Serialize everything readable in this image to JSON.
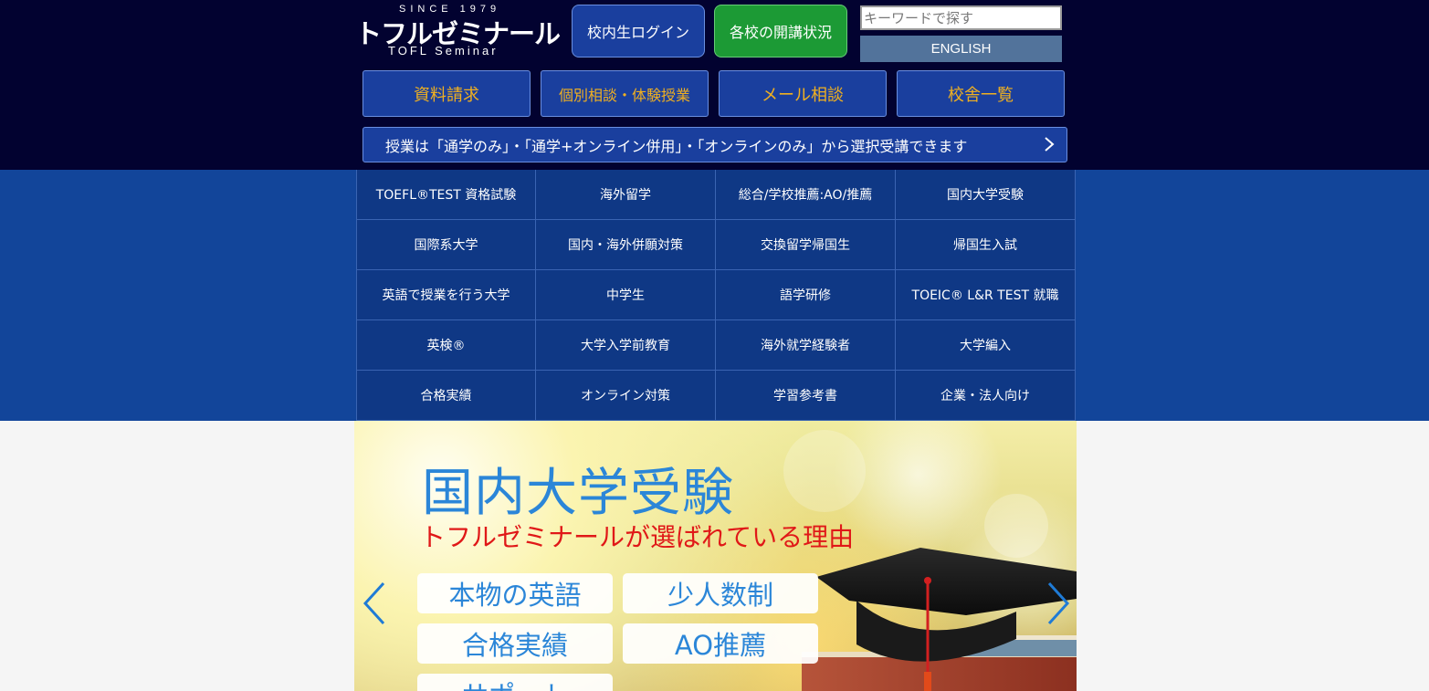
{
  "header": {
    "logo": {
      "since": "SINCE 1979",
      "name": "トフルゼミナール",
      "english": "TOFL Seminar"
    },
    "login_label": "校内生ログイン",
    "status_label": "各校の開講状況",
    "search": {
      "placeholder": "キーワードで探す",
      "value": ""
    },
    "english_label": "ENGLISH",
    "actions": [
      "資料請求",
      "個別相談・体験授業",
      "メール相談",
      "校舎一覧"
    ],
    "notice": "授業は「通学のみ」・「通学+オンライン併用」・「オンラインのみ」から選択受講できます",
    "colors": {
      "background": "#020230",
      "button": "#1a3f9e",
      "accent": "#f0b020",
      "status_button": "#1c9a35"
    }
  },
  "nav": {
    "items": [
      "TOEFL®TEST 資格試験",
      "海外留学",
      "総合/学校推薦:AO/推薦",
      "国内大学受験",
      "国際系大学",
      "国内・海外併願対策",
      "交換留学帰国生",
      "帰国生入試",
      "英語で授業を行う大学",
      "中学生",
      "語学研修",
      "TOEIC® L&R TEST 就職",
      "英検®",
      "大学入学前教育",
      "海外就学経験者",
      "大学編入",
      "合格実績",
      "オンライン対策",
      "学習参考書",
      "企業・法人向け"
    ],
    "colors": {
      "band": "#12459a",
      "cell": "#0f3885"
    }
  },
  "banner": {
    "title": "国内大学受験",
    "subtitle": "トフルゼミナールが選ばれている理由",
    "tags": [
      "本物の英語",
      "少人数制",
      "合格実績",
      "AO推薦",
      "サポート"
    ],
    "colors": {
      "title": "#2b86d8",
      "subtitle": "#e01818"
    },
    "icons": {
      "prev": "chevron-left-icon",
      "next": "chevron-right-icon"
    }
  }
}
